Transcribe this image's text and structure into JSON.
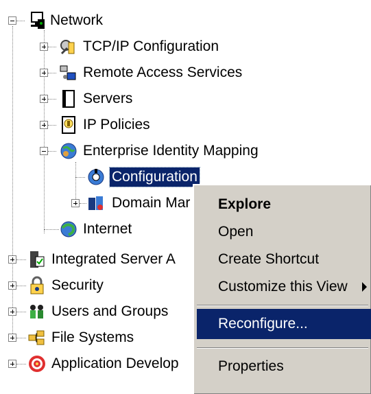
{
  "tree": {
    "network": "Network",
    "tcpip": "TCP/IP Configuration",
    "remote_access": "Remote Access Services",
    "servers": "Servers",
    "ip_policies": "IP Policies",
    "eim": "Enterprise Identity Mapping",
    "configuration": "Configuration",
    "domain": "Domain Mar",
    "internet": "Internet",
    "integrated_server": "Integrated Server A",
    "security": "Security",
    "users_groups": "Users and Groups",
    "file_systems": "File Systems",
    "app_dev": "Application Develop"
  },
  "context_menu": {
    "explore": "Explore",
    "open": "Open",
    "create_shortcut": "Create Shortcut",
    "customize_view": "Customize this View",
    "reconfigure": "Reconfigure...",
    "properties": "Properties"
  },
  "colors": {
    "selection": "#0a246a",
    "menu_bg": "#d4d0c8"
  }
}
